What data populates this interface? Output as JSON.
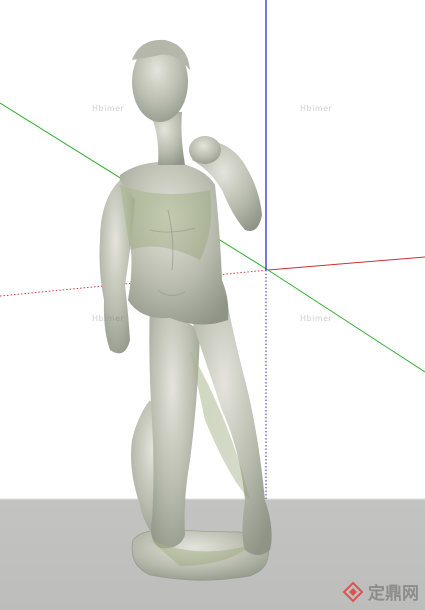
{
  "watermarks": [
    "Hbimer",
    "Hbimer",
    "Hbimer",
    "Hbimer"
  ],
  "logo": {
    "text": "定鼎网",
    "icon": "diamond-logo-icon",
    "color": "#d9534f"
  },
  "axes": {
    "red": "#d03030",
    "green": "#20b020",
    "blue": "#2020d0"
  },
  "ground_color": "#c0c0be"
}
